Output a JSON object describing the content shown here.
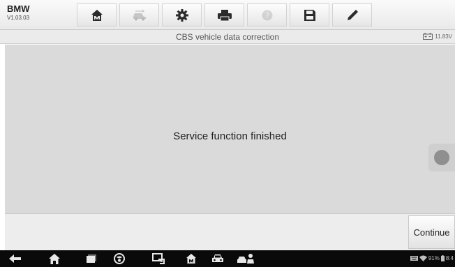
{
  "header": {
    "vehicle_make": "BMW",
    "software_version": "V1.03.03",
    "toolbar": [
      {
        "icon": "home-icon",
        "enabled": true
      },
      {
        "icon": "vehicle-swap-icon",
        "enabled": false
      },
      {
        "icon": "settings-gear-icon",
        "enabled": true
      },
      {
        "icon": "print-icon",
        "enabled": true
      },
      {
        "icon": "help-icon",
        "enabled": false
      },
      {
        "icon": "save-icon",
        "enabled": true
      },
      {
        "icon": "pen-icon",
        "enabled": true
      }
    ]
  },
  "title_bar": {
    "title": "CBS vehicle data correction",
    "battery_voltage": "11.83V"
  },
  "main": {
    "message": "Service function finished"
  },
  "footer": {
    "continue_label": "Continue"
  },
  "system_bar": {
    "buttons": [
      "back-icon",
      "home-icon",
      "recent-apps-icon",
      "browser-icon",
      "remote-icon",
      "mb-home-icon",
      "car-icon",
      "vci-icon"
    ],
    "battery_percent": "91%",
    "clock": "8:4"
  },
  "colors": {
    "main_background": "#dadada",
    "footer_background": "#ededed",
    "system_bar": "#0a0a0a"
  }
}
